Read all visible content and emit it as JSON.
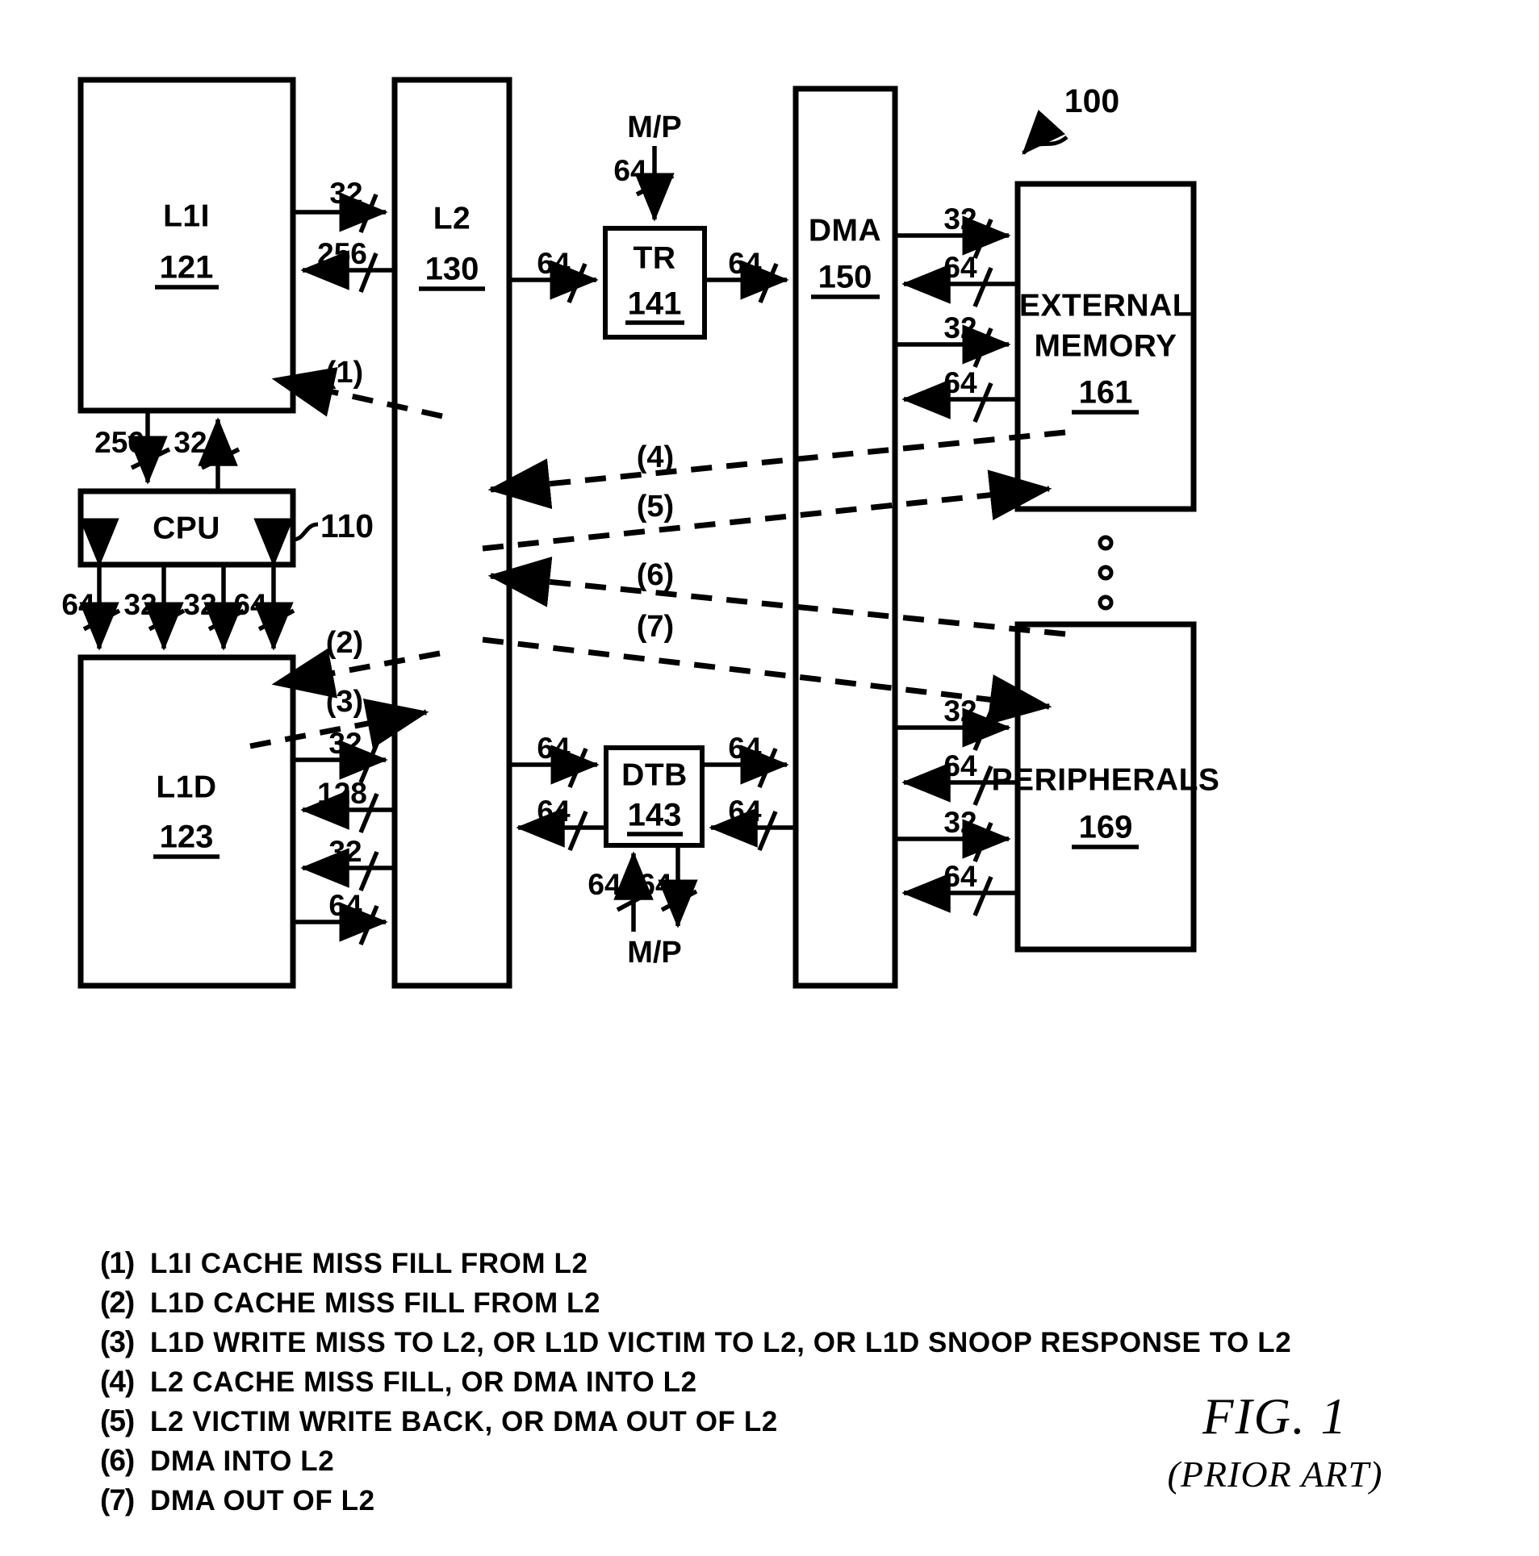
{
  "figure": {
    "caption_main": "FIG. 1",
    "caption_sub": "(PRIOR ART)",
    "system_ref": "100"
  },
  "blocks": {
    "l1i": {
      "label": "L1I",
      "ref": "121"
    },
    "l2": {
      "label": "L2",
      "ref": "130"
    },
    "tr": {
      "label": "TR",
      "ref": "141"
    },
    "dma": {
      "label": "DMA",
      "ref": "150"
    },
    "external_memory": {
      "label_line1": "EXTERNAL",
      "label_line2": "MEMORY",
      "ref": "161"
    },
    "cpu": {
      "label": "CPU",
      "ref": "110"
    },
    "l1d": {
      "label": "L1D",
      "ref": "123"
    },
    "dtb": {
      "label": "DTB",
      "ref": "143"
    },
    "peripherals": {
      "label": "PERIPHERALS",
      "ref": "169"
    }
  },
  "bus_widths": {
    "l1i_to_l2": "32",
    "l2_to_l1i": "256",
    "l2_to_tr": "64",
    "tr_to_dma": "64",
    "mp_to_tr": "64",
    "dma_to_extmem_a": "32",
    "extmem_to_dma_a": "64",
    "dma_to_extmem_b": "32",
    "extmem_to_dma_b": "64",
    "l1i_to_cpu": "256",
    "cpu_to_l1i": "32",
    "cpu_l1d_1": "64",
    "cpu_l1d_2": "32",
    "cpu_l1d_3": "32",
    "cpu_l1d_4": "64",
    "l1d_to_l2_a": "32",
    "l2_to_l1d_a": "128",
    "l2_to_l1d_b": "32",
    "l1d_to_l2_b": "64",
    "l2_to_dtb": "64",
    "dtb_to_l2": "64",
    "dtb_to_dma": "64",
    "dma_to_dtb": "64",
    "mp_in_dtb": "64",
    "mp_out_dtb": "64",
    "dma_to_periph_a": "32",
    "periph_to_dma_a": "64",
    "dma_to_periph_b": "32",
    "periph_to_dma_b": "64"
  },
  "signals": {
    "mp_top": "M/P",
    "mp_bottom": "M/P"
  },
  "flow_markers": {
    "f1": "(1)",
    "f2": "(2)",
    "f3": "(3)",
    "f4": "(4)",
    "f5": "(5)",
    "f6": "(6)",
    "f7": "(7)"
  },
  "legend": [
    {
      "index": "(1)",
      "text": "L1I CACHE MISS FILL FROM L2"
    },
    {
      "index": "(2)",
      "text": "L1D CACHE MISS FILL FROM L2"
    },
    {
      "index": "(3)",
      "text": "L1D WRITE MISS TO L2, OR L1D VICTIM TO L2, OR L1D SNOOP RESPONSE TO L2"
    },
    {
      "index": "(4)",
      "text": "L2 CACHE MISS FILL, OR DMA INTO L2"
    },
    {
      "index": "(5)",
      "text": "L2 VICTIM WRITE BACK, OR DMA OUT OF L2"
    },
    {
      "index": "(6)",
      "text": "DMA INTO L2"
    },
    {
      "index": "(7)",
      "text": "DMA OUT OF L2"
    }
  ],
  "colors": {
    "ink": "#000000",
    "paper": "#ffffff"
  }
}
